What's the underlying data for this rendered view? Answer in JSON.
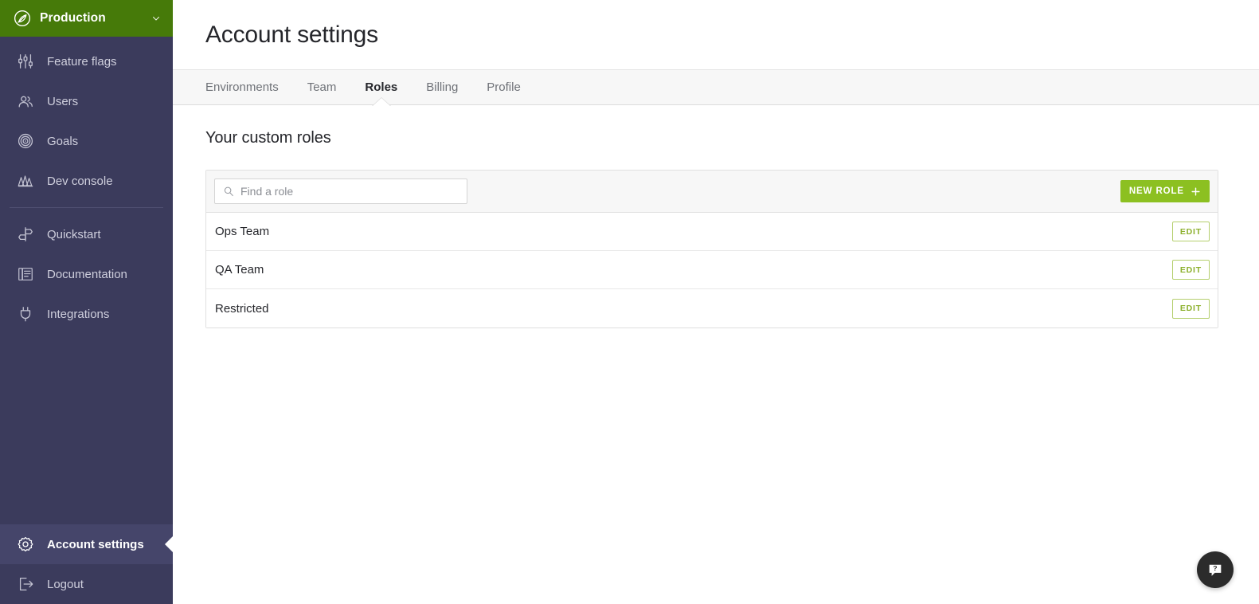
{
  "sidebar": {
    "environment": {
      "name": "Production",
      "logo_icon": "leaf-logo-icon",
      "caret_icon": "chevron-down-icon",
      "bg_color": "#467a09"
    },
    "primary_items": [
      {
        "label": "Feature flags",
        "icon": "sliders-icon"
      },
      {
        "label": "Users",
        "icon": "users-icon"
      },
      {
        "label": "Goals",
        "icon": "target-icon"
      },
      {
        "label": "Dev console",
        "icon": "waveform-icon"
      }
    ],
    "secondary_items": [
      {
        "label": "Quickstart",
        "icon": "signpost-icon"
      },
      {
        "label": "Documentation",
        "icon": "book-icon"
      },
      {
        "label": "Integrations",
        "icon": "plug-icon"
      }
    ],
    "bottom_items": [
      {
        "label": "Account settings",
        "icon": "gear-icon",
        "active": true
      },
      {
        "label": "Logout",
        "icon": "logout-icon",
        "active": false
      }
    ],
    "bg_color": "#3b3b5c",
    "active_bg_color": "#45456a"
  },
  "header": {
    "title": "Account settings"
  },
  "tabs": [
    {
      "label": "Environments",
      "active": false
    },
    {
      "label": "Team",
      "active": false
    },
    {
      "label": "Roles",
      "active": true
    },
    {
      "label": "Billing",
      "active": false
    },
    {
      "label": "Profile",
      "active": false
    }
  ],
  "main": {
    "section_title": "Your custom roles",
    "search": {
      "placeholder": "Find a role",
      "value": "",
      "icon": "search-icon"
    },
    "new_role_button": {
      "label": "NEW ROLE",
      "icon": "plus-icon",
      "color": "#8cc021"
    },
    "roles": [
      {
        "name": "Ops Team",
        "edit_label": "EDIT"
      },
      {
        "name": "QA Team",
        "edit_label": "EDIT"
      },
      {
        "name": "Restricted",
        "edit_label": "EDIT"
      }
    ],
    "edit_button_color": "#8cb02c"
  },
  "help_button": {
    "icon": "question-bubble-icon",
    "label": "?"
  }
}
